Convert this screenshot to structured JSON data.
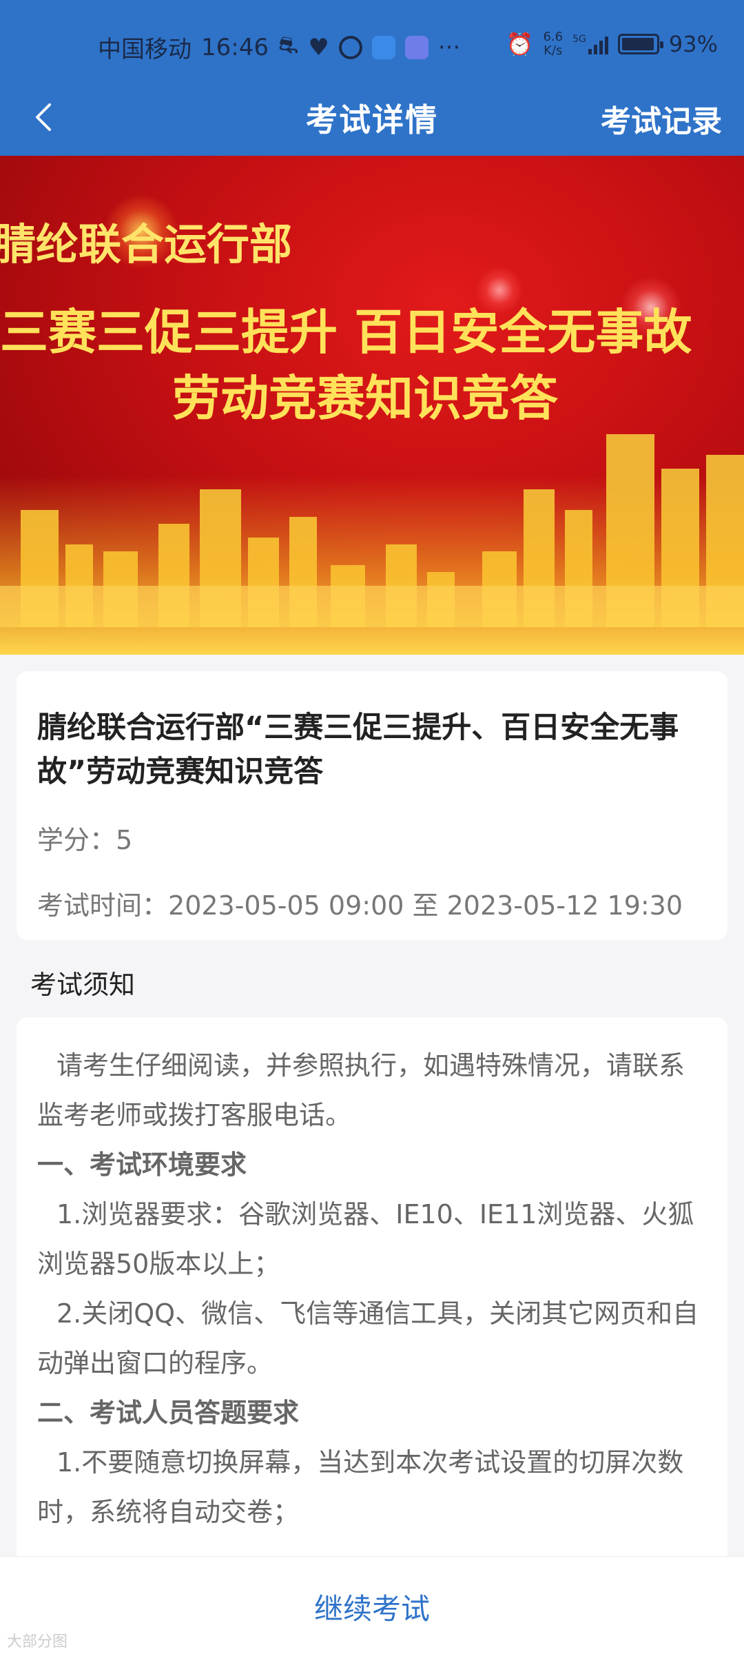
{
  "status_bar": {
    "carrier": "中国移动",
    "time": "16:46",
    "net_speed_value": "6.6",
    "net_speed_unit": "K/s",
    "network": "5G",
    "battery": "93%",
    "icons": [
      "notification-icon",
      "health-icon",
      "ring-icon",
      "app-icon",
      "music-icon",
      "more-icon",
      "alarm-icon",
      "signal-icon",
      "battery-icon"
    ]
  },
  "nav": {
    "title": "考试详情",
    "right_label": "考试记录",
    "back_icon": "chevron-left-icon"
  },
  "banner": {
    "line1": "腈纶联合运行部",
    "line2": "三赛三促三提升 百日安全无事故",
    "line3": "劳动竞赛知识竞答"
  },
  "exam": {
    "title": "腈纶联合运行部“三赛三促三提升、百日安全无事故”劳动竞赛知识竞答",
    "credit_label": "学分：",
    "credit_value": "5",
    "time_label": "考试时间：",
    "time_value": "2023-05-05 09:00 至 2023-05-12 19:30"
  },
  "notice": {
    "section_title": "考试须知",
    "intro": "请考生仔细阅读，并参照执行，如遇特殊情况，请联系监考老师或拨打客服电话。",
    "h1": "一、考试环境要求",
    "h1_item1": "1.浏览器要求：谷歌浏览器、IE10、IE11浏览器、火狐浏览器50版本以上；",
    "h1_item2": "2.关闭QQ、微信、飞信等通信工具，关闭其它网页和自动弹出窗口的程序。",
    "h2": "二、考试人员答题要求",
    "h2_item1": "1.不要随意切换屏幕，当达到本次考试设置的切屏次数时，系统将自动交卷；"
  },
  "footer": {
    "continue_label": "继续考试",
    "watermark": "大部分图"
  },
  "colors": {
    "primary": "#2f73c9",
    "banner_red": "#c30f12",
    "banner_gold": "#ffe25a"
  }
}
